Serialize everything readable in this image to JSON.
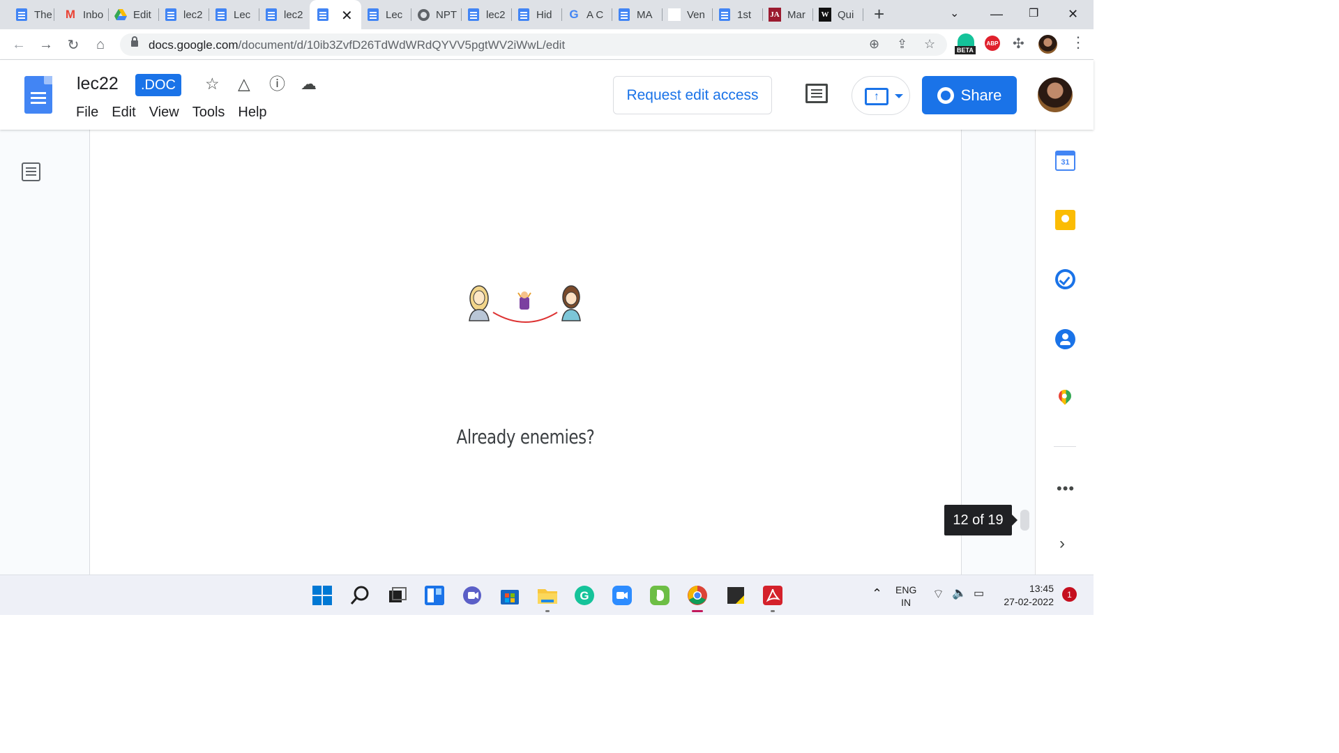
{
  "browser": {
    "tabs": [
      {
        "label": "The",
        "icon": "google-docs-icon"
      },
      {
        "label": "Inbo",
        "icon": "gmail-icon"
      },
      {
        "label": "Edit",
        "icon": "google-drive-icon"
      },
      {
        "label": "lec2",
        "icon": "google-docs-icon"
      },
      {
        "label": "Lec",
        "icon": "google-docs-icon"
      },
      {
        "label": "lec2",
        "icon": "google-docs-icon"
      },
      {
        "label": "",
        "icon": "google-docs-icon",
        "active": true
      },
      {
        "label": "Lec",
        "icon": "google-docs-icon"
      },
      {
        "label": "NPT",
        "icon": "globe-icon"
      },
      {
        "label": "lec2",
        "icon": "google-docs-icon"
      },
      {
        "label": "Hid",
        "icon": "google-docs-icon"
      },
      {
        "label": "A C",
        "icon": "google-icon"
      },
      {
        "label": "MA",
        "icon": "google-docs-icon"
      },
      {
        "label": "Ven",
        "icon": "blank-page-icon"
      },
      {
        "label": "1st",
        "icon": "google-docs-icon"
      },
      {
        "label": "Mar",
        "icon": "ja-icon",
        "icon_text": "JA"
      },
      {
        "label": "Qui",
        "icon": "w-icon",
        "icon_text": "W"
      }
    ],
    "url_host": "docs.google.com",
    "url_path": "/document/d/10ib3ZvfD26TdWdWRdQYVV5pgtWV2iWwL/edit",
    "beta_label": "BETA",
    "abp_label": "ABP"
  },
  "docs": {
    "title": "lec22",
    "badge": ".DOC",
    "menu": [
      "File",
      "Edit",
      "View",
      "Tools",
      "Help"
    ],
    "request_edit": "Request edit access",
    "share": "Share"
  },
  "page": {
    "caption": "Already enemies?",
    "page_indicator": "12 of 19"
  },
  "side_panel": {
    "calendar_date": "31",
    "more": "•••"
  },
  "taskbar": {
    "apps": [
      "windows-start-icon",
      "search-icon",
      "task-view-icon",
      "widgets-icon",
      "teams-chat-icon",
      "microsoft-store-icon",
      "file-explorer-icon",
      "grammarly-icon",
      "zoom-icon",
      "evernote-icon",
      "chrome-icon",
      "sticky-notes-icon",
      "acrobat-icon"
    ],
    "lang_top": "ENG",
    "lang_bottom": "IN",
    "time": "13:45",
    "date": "27-02-2022",
    "notifications": "1"
  },
  "colors": {
    "accent": "#1a73e8",
    "docs_blue": "#4285f4",
    "page_bg": "#f9fbfd"
  }
}
